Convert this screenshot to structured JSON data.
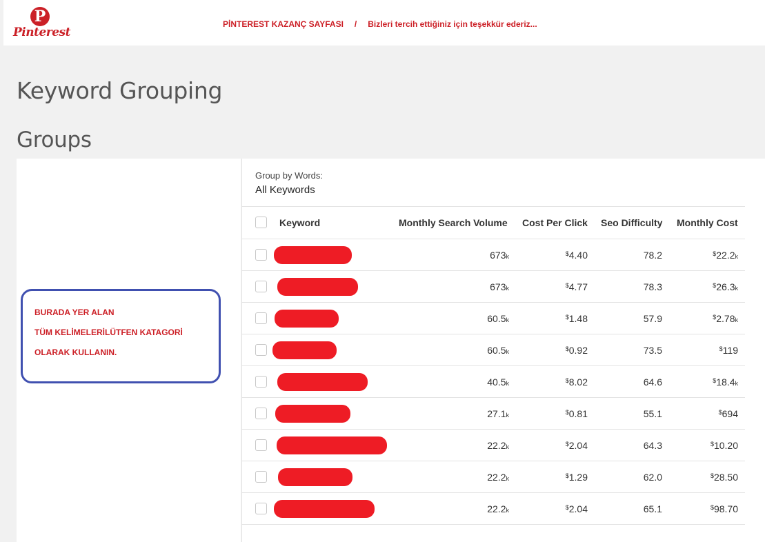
{
  "header": {
    "logo_mark": "P",
    "logo_word": "Pinterest",
    "nav_title": "PİNTEREST KAZANÇ SAYFASI",
    "nav_separator": "/",
    "nav_subtitle": "Bizleri tercih ettiğiniz için teşekkür ederiz..."
  },
  "page_title": "Keyword Grouping",
  "groups_title": "Groups",
  "note": {
    "lines": [
      "BURADA YER ALAN",
      "TÜM KELİMELERİLÜTFEN KATAGORİ",
      "OLARAK KULLANIN."
    ]
  },
  "grouping": {
    "label": "Group by Words:",
    "value": "All Keywords"
  },
  "table": {
    "headers": {
      "keyword": "Keyword",
      "volume": "Monthly Search Volume",
      "cpc": "Cost Per Click",
      "difficulty": "Seo Difficulty",
      "cost": "Monthly Cost"
    },
    "rows": [
      {
        "volume": "673",
        "volume_suffix": "k",
        "cpc": "4.40",
        "difficulty": "78.2",
        "cost": "22.2",
        "cost_suffix": "k"
      },
      {
        "volume": "673",
        "volume_suffix": "k",
        "cpc": "4.77",
        "difficulty": "78.3",
        "cost": "26.3",
        "cost_suffix": "k"
      },
      {
        "volume": "60.5",
        "volume_suffix": "k",
        "cpc": "1.48",
        "difficulty": "57.9",
        "cost": "2.78",
        "cost_suffix": "k"
      },
      {
        "volume": "60.5",
        "volume_suffix": "k",
        "cpc": "0.92",
        "difficulty": "73.5",
        "cost": "119",
        "cost_suffix": ""
      },
      {
        "volume": "40.5",
        "volume_suffix": "k",
        "cpc": "8.02",
        "difficulty": "64.6",
        "cost": "18.4",
        "cost_suffix": "k"
      },
      {
        "volume": "27.1",
        "volume_suffix": "k",
        "cpc": "0.81",
        "difficulty": "55.1",
        "cost": "694",
        "cost_suffix": ""
      },
      {
        "volume": "22.2",
        "volume_suffix": "k",
        "cpc": "2.04",
        "difficulty": "64.3",
        "cost": "10.20",
        "cost_suffix": ""
      },
      {
        "volume": "22.2",
        "volume_suffix": "k",
        "cpc": "1.29",
        "difficulty": "62.0",
        "cost": "28.50",
        "cost_suffix": ""
      },
      {
        "volume": "22.2",
        "volume_suffix": "k",
        "cpc": "2.04",
        "difficulty": "65.1",
        "cost": "98.70",
        "cost_suffix": ""
      }
    ],
    "currency_symbol": "$"
  },
  "colors": {
    "brand_red": "#cb2027",
    "redaction": "#ee1c25",
    "note_border": "#4050b0"
  }
}
